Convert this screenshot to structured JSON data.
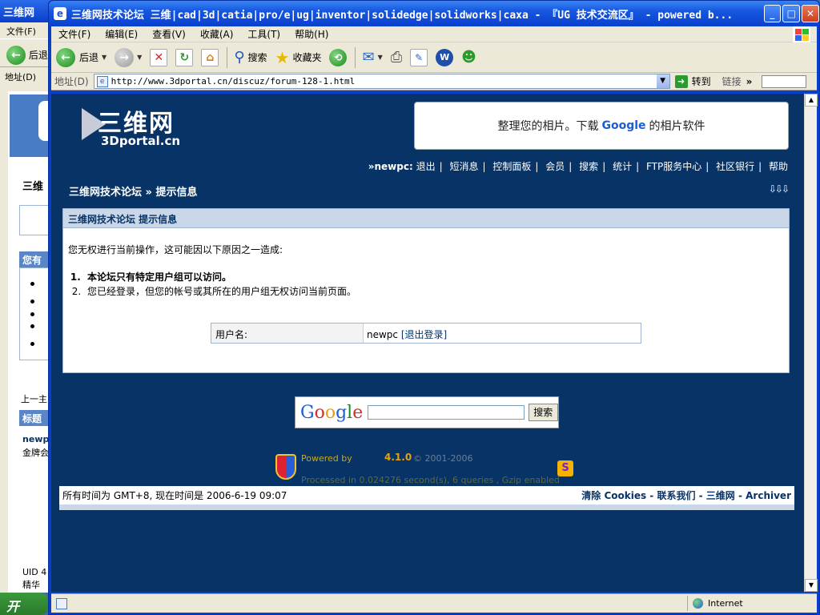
{
  "bg_window": {
    "title": "三维网",
    "menu": "文件(F)",
    "back": "后退",
    "address": "地址(D)",
    "heading": "三维",
    "box_head_1": "您有",
    "box_head_2": "标题",
    "line_1": "上一主",
    "user": "newp",
    "rank": "金牌会",
    "uid": "UID 4",
    "jinghua": "精华"
  },
  "window": {
    "title": "三维网技术论坛 三维|cad|3d|catia|pro/e|ug|inventor|solidedge|solidworks|caxa - 『UG 技术交流区』 - powered b...",
    "app_icon": "e"
  },
  "menu": [
    "文件(F)",
    "编辑(E)",
    "查看(V)",
    "收藏(A)",
    "工具(T)",
    "帮助(H)"
  ],
  "toolbar": {
    "back": "后退",
    "search": "搜索",
    "favorites": "收藏夹"
  },
  "address": {
    "label": "地址(D)",
    "url": "http://www.3dportal.cn/discuz/forum-128-1.html",
    "go": "转到",
    "links": "链接",
    "more": "»"
  },
  "page": {
    "logo_cn": "三维网",
    "logo_en": "3Dportal.cn",
    "ad_prefix": "整理您的相片。下载",
    "ad_google": "Google",
    "ad_suffix": "的相片软件",
    "nav_user": "»newpc:",
    "nav": [
      "退出",
      "短消息",
      "控制面板",
      "会员",
      "搜索",
      "统计",
      "FTP服务中心",
      "社区银行",
      "帮助"
    ],
    "breadcrumb": "三维网技术论坛 » 提示信息",
    "expand": "⇩⇩⇩",
    "panel_head": "三维网技术论坛 提示信息",
    "message": "您无权进行当前操作，这可能因以下原因之一造成:",
    "reasons": [
      "本论坛只有特定用户组可以访问。",
      "您已经登录，但您的帐号或其所在的用户组无权访问当前页面。"
    ],
    "username_label": "用户名:",
    "username_value": "newpc",
    "logout_link": "[退出登录]",
    "search_button": "搜索",
    "powered_by": "Powered by",
    "version": "4.1.0",
    "copyright": "© 2001-2006",
    "processed": "Processed in 0.024276 second(s), 6 queries , Gzip enabled",
    "footer_time": "所有时间为 GMT+8, 现在时间是 2006-6-19 09:07",
    "footer_links": "清除 Cookies - 联系我们 - 三维网 - Archiver"
  },
  "status": {
    "zone": "Internet"
  },
  "taskbar": {
    "start": "开"
  }
}
